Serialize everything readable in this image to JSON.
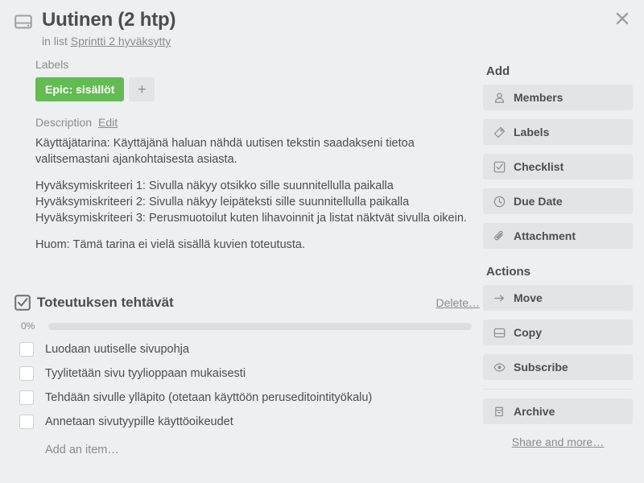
{
  "card": {
    "icon": "card-icon",
    "title": "Uutinen (2 htp)",
    "in_list_prefix": "in list",
    "list_name": "Sprintti 2 hyväksytty",
    "close_icon": "close-icon"
  },
  "labels": {
    "heading": "Labels",
    "chips": [
      {
        "text": "Epic: sisällöt",
        "color": "#61bd4f"
      }
    ],
    "add_label": "+"
  },
  "description": {
    "heading": "Description",
    "edit_label": "Edit",
    "paragraphs": [
      "Käyttäjätarina: Käyttäjänä haluan nähdä uutisen tekstin saadakseni tietoa valitsemastani ajankohtaisesta asiasta."
    ],
    "criteria": [
      "Hyväksymiskriteeri 1: Sivulla näkyy otsikko sille suunnitellulla paikalla",
      "Hyväksymiskriteeri 2: Sivulla näkyy leipäteksti sille suunnitellulla paikalla",
      "Hyväksymiskriteeri 3: Perusmuotoilut kuten lihavoinnit ja listat näktvät sivulla oikein."
    ],
    "note": "Huom: Tämä tarina ei vielä sisällä kuvien toteutusta."
  },
  "checklist": {
    "icon": "checklist-icon",
    "title": "Toteutuksen tehtävät",
    "delete_label": "Delete…",
    "progress_percent": "0%",
    "progress_value": 0,
    "items": [
      {
        "text": "Luodaan uutiselle sivupohja",
        "checked": false
      },
      {
        "text": "Tyylitetään sivu tyylioppaan mukaisesti",
        "checked": false
      },
      {
        "text": "Tehdään sivulle ylläpito (otetaan käyttöön peruseditointityökalu)",
        "checked": false
      },
      {
        "text": "Annetaan sivutyypille käyttöoikeudet",
        "checked": false
      }
    ],
    "add_item_label": "Add an item…"
  },
  "sidebar": {
    "add_heading": "Add",
    "add_buttons": [
      {
        "label": "Members",
        "icon": "person-icon"
      },
      {
        "label": "Labels",
        "icon": "tag-icon"
      },
      {
        "label": "Checklist",
        "icon": "checkbox-icon"
      },
      {
        "label": "Due Date",
        "icon": "clock-icon"
      },
      {
        "label": "Attachment",
        "icon": "paperclip-icon"
      }
    ],
    "actions_heading": "Actions",
    "action_buttons": [
      {
        "label": "Move",
        "icon": "arrow-right-icon"
      },
      {
        "label": "Copy",
        "icon": "card-copy-icon"
      },
      {
        "label": "Subscribe",
        "icon": "eye-icon"
      }
    ],
    "archive_button": {
      "label": "Archive",
      "icon": "archive-icon"
    },
    "share_label": "Share and more…"
  },
  "colors": {
    "background": "#edeff0",
    "button": "#e2e4e6",
    "label_green": "#61bd4f",
    "text": "#4d4d4d",
    "muted": "#8c8c8c"
  }
}
